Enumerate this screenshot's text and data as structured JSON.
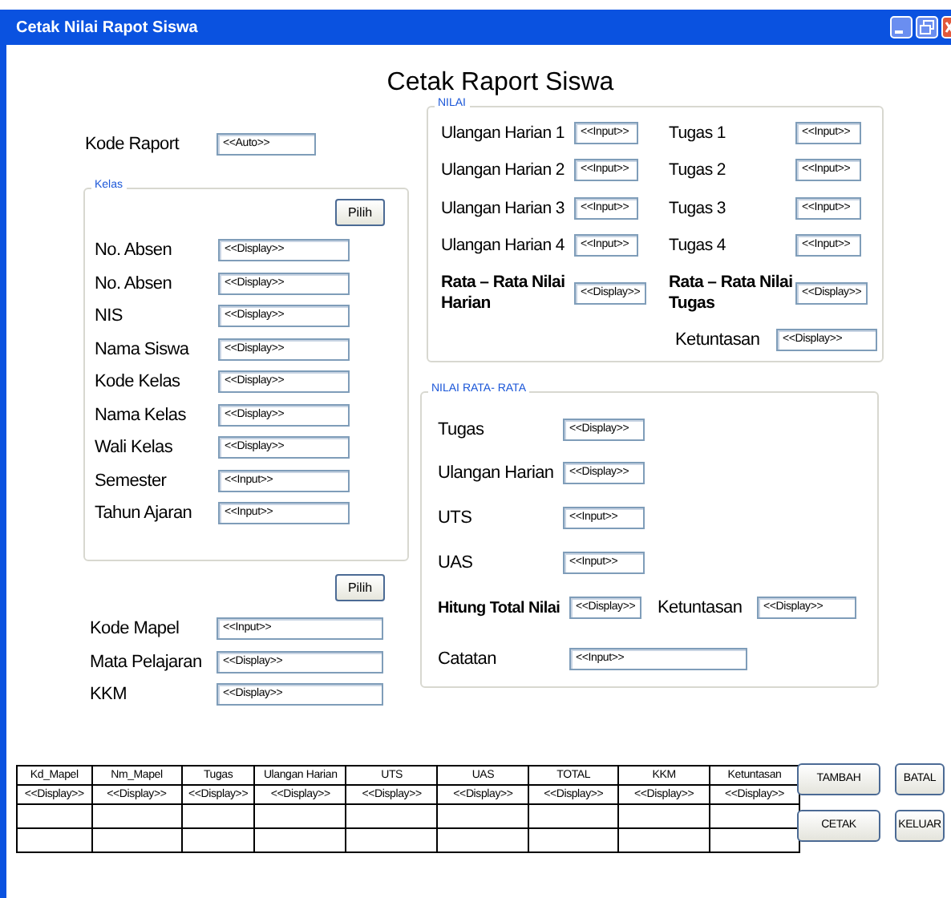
{
  "window": {
    "title": "Cetak Nilai Rapot Siswa"
  },
  "heading": "Cetak Raport Siswa",
  "kode_raport": {
    "label": "Kode Raport",
    "value": "<<Auto>>"
  },
  "kelas": {
    "legend": "Kelas",
    "button": "Pilih",
    "fields": [
      {
        "label": "No. Absen",
        "value": "<<Display>>"
      },
      {
        "label": "No. Absen",
        "value": "<<Display>>"
      },
      {
        "label": "NIS",
        "value": "<<Display>>"
      },
      {
        "label": "Nama Siswa",
        "value": "<<Display>>"
      },
      {
        "label": "Kode Kelas",
        "value": "<<Display>>"
      },
      {
        "label": "Nama Kelas",
        "value": "<<Display>>"
      },
      {
        "label": "Wali Kelas",
        "value": "<<Display>>"
      },
      {
        "label": "Semester",
        "value": "<<Input>>"
      },
      {
        "label": "Tahun Ajaran",
        "value": "<<Input>>"
      }
    ]
  },
  "mapel": {
    "button": "Pilih",
    "fields": [
      {
        "label": "Kode Mapel",
        "value": "<<Input>>"
      },
      {
        "label": "Mata Pelajaran",
        "value": "<<Display>>"
      },
      {
        "label": "KKM",
        "value": "<<Display>>"
      }
    ]
  },
  "nilai": {
    "legend": "NILAI",
    "harian": [
      {
        "label": "Ulangan Harian 1",
        "value": "<<Input>>"
      },
      {
        "label": "Ulangan Harian 2",
        "value": "<<Input>>"
      },
      {
        "label": "Ulangan Harian 3",
        "value": "<<Input>>"
      },
      {
        "label": "Ulangan Harian 4",
        "value": "<<Input>>"
      }
    ],
    "tugas": [
      {
        "label": "Tugas 1",
        "value": "<<Input>>"
      },
      {
        "label": "Tugas 2",
        "value": "<<Input>>"
      },
      {
        "label": "Tugas 3",
        "value": "<<Input>>"
      },
      {
        "label": "Tugas 4",
        "value": "<<Input>>"
      }
    ],
    "rata_harian": {
      "label": "Rata – Rata Nilai Harian",
      "value": "<<Display>>"
    },
    "rata_tugas": {
      "label": "Rata – Rata Nilai Tugas",
      "value": "<<Display>>"
    },
    "ketuntasan": {
      "label": "Ketuntasan",
      "value": "<<Display>>"
    }
  },
  "nilai_rata_rata": {
    "legend": "NILAI RATA- RATA",
    "fields": [
      {
        "label": "Tugas",
        "value": "<<Display>>"
      },
      {
        "label": "Ulangan Harian",
        "value": "<<Display>>"
      },
      {
        "label": "UTS",
        "value": "<<Input>>"
      },
      {
        "label": "UAS",
        "value": "<<Input>>"
      }
    ],
    "total": {
      "label": "Hitung Total Nilai",
      "value": "<<Display>>"
    },
    "ketuntasan": {
      "label": "Ketuntasan",
      "value": "<<Display>>"
    },
    "catatan": {
      "label": "Catatan",
      "value": "<<Input>>"
    }
  },
  "table": {
    "columns": [
      "Kd_Mapel",
      "Nm_Mapel",
      "Tugas",
      "Ulangan Harian",
      "UTS",
      "UAS",
      "TOTAL",
      "KKM",
      "Ketuntasan"
    ],
    "rows": [
      [
        "<<Display>>",
        "<<Display>>",
        "<<Display>>",
        "<<Display>>",
        "<<Display>>",
        "<<Display>>",
        "<<Display>>",
        "<<Display>>",
        "<<Display>>"
      ]
    ]
  },
  "buttons": [
    "TAMBAH",
    "BATAL",
    "CETAK",
    "KELUAR"
  ]
}
